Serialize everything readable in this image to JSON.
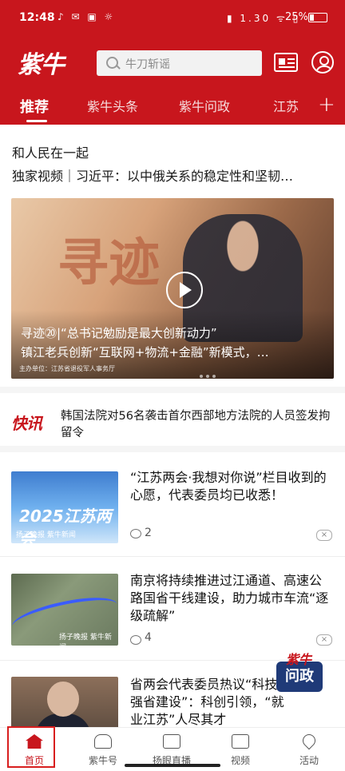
{
  "status_bar": {
    "time": "12:48",
    "left_icons": "♪ ✉ ▣ ☼",
    "right_icons": "▮ 1.30 ᯤ ▯",
    "battery": "25%"
  },
  "header": {
    "logo": "紫牛",
    "search_placeholder": "牛刀斩谣",
    "colors": {
      "brand": "#c8161d"
    }
  },
  "tabs": [
    {
      "label": "推荐",
      "active": true
    },
    {
      "label": "紫牛头条"
    },
    {
      "label": "紫牛问政"
    },
    {
      "label": "江苏"
    }
  ],
  "feed": {
    "top_headline": "和人民在一起",
    "top_subhead": "独家视频｜习近平：以中俄关系的稳定性和坚韧…",
    "hero": {
      "calligraphy": "寻迹",
      "caption_line1": "寻迹⑳|“总书记勉励是最大创新动力”",
      "caption_line2": "镇江老兵创新“互联网+物流+金融”新模式，…",
      "footer": "主办单位：江苏省退役军人事务厅"
    },
    "kuaixun": {
      "logo": "快讯",
      "text": "韩国法院对56名袭击首尔西部地方法院的人员签发拘留令"
    },
    "articles": [
      {
        "title": "“江苏两会·我想对你说”栏目收到的心愿，代表委员均已收悉！",
        "thumb_text": "2025江苏两会",
        "thumb_brand": "扬子晚报 紫牛新闻",
        "comments": "2"
      },
      {
        "title": "南京将持续推进过江通道、高速公路国省干线建设，助力城市车流“逐级疏解”",
        "thumb_brand": "扬子晚报 紫牛新闻",
        "comments": "4"
      },
      {
        "title": "省两会代表委员热议“科技强省建设”：科创引领，“就业江苏”人尽其才"
      }
    ],
    "close_icon_label": "×",
    "floating_badge": {
      "top": "紫牛",
      "main": "问政"
    }
  },
  "bottom_nav": [
    {
      "label": "首页",
      "icon": "home-icon",
      "active": true
    },
    {
      "label": "紫牛号",
      "icon": "ox-icon"
    },
    {
      "label": "扬眼直播",
      "icon": "video-icon"
    },
    {
      "label": "视频",
      "icon": "clapper-icon"
    },
    {
      "label": "活动",
      "icon": "location-icon"
    }
  ]
}
